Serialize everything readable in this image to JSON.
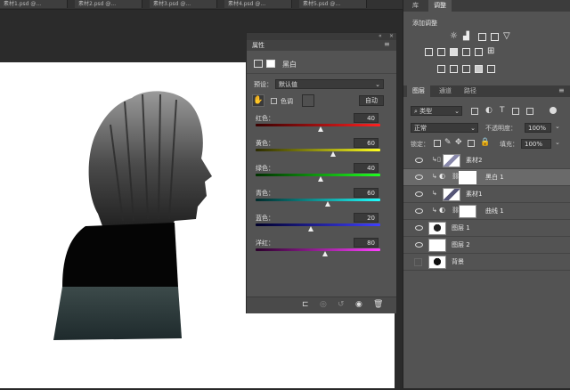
{
  "document_tabs": [
    "素材1.psd @...",
    "素材2.psd @...",
    "素材3.psd @...",
    "素材4.psd @...",
    "素材5.psd @..."
  ],
  "right_top_tabs": {
    "library": "库",
    "adjustments": "调整"
  },
  "adjustments_panel": {
    "title": "添加调整"
  },
  "properties_panel": {
    "title": "属性",
    "adjustment_name": "黑白",
    "preset_label": "预设：",
    "preset_value": "默认值",
    "tint_label": "色调",
    "auto_button": "自动",
    "sliders": [
      {
        "label": "红色：",
        "value": "40",
        "fraction": 0.52,
        "gradient": "linear-gradient(90deg,#3a0000,#ff2020)"
      },
      {
        "label": "黄色：",
        "value": "60",
        "fraction": 0.62,
        "gradient": "linear-gradient(90deg,#2a2a00,#ffff20)"
      },
      {
        "label": "绿色：",
        "value": "40",
        "fraction": 0.52,
        "gradient": "linear-gradient(90deg,#003000,#20ff20)"
      },
      {
        "label": "青色：",
        "value": "60",
        "fraction": 0.58,
        "gradient": "linear-gradient(90deg,#002a2a,#20ffff)"
      },
      {
        "label": "蓝色：",
        "value": "20",
        "fraction": 0.44,
        "gradient": "linear-gradient(90deg,#00002a,#4040ff)"
      },
      {
        "label": "洋红：",
        "value": "80",
        "fraction": 0.56,
        "gradient": "linear-gradient(90deg,#2a002a,#ff40ff)"
      }
    ]
  },
  "layers_panel": {
    "tabs": [
      "图层",
      "通道",
      "路径"
    ],
    "filter_label": "类型",
    "blend_mode": "正常",
    "opacity_label": "不透明度：",
    "opacity_value": "100%",
    "lock_label": "锁定：",
    "fill_label": "填充：",
    "fill_value": "100%",
    "layers": [
      {
        "name": "素材2",
        "visible": true,
        "selected": false
      },
      {
        "name": "黑白 1",
        "visible": true,
        "selected": true
      },
      {
        "name": "素材1",
        "visible": true,
        "selected": false
      },
      {
        "name": "曲线 1",
        "visible": true,
        "selected": false
      },
      {
        "name": "图层 1",
        "visible": true,
        "selected": false
      },
      {
        "name": "图层 2",
        "visible": true,
        "selected": false
      },
      {
        "name": "背景",
        "visible": false,
        "selected": false
      }
    ]
  }
}
